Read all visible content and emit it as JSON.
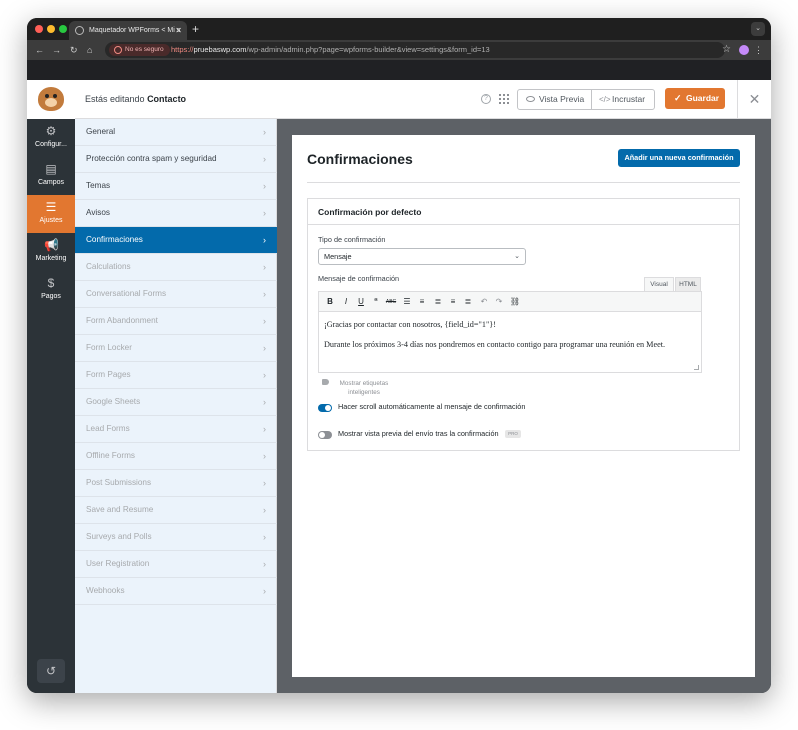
{
  "browser": {
    "tab_title": "Maquetador WPForms < Mi s",
    "tab_close": "✕",
    "new_tab": "+",
    "insecure_label": "No es seguro",
    "url_scheme": "https://",
    "url_host": "pruebaswp.com",
    "url_path": "/wp-admin/admin.php?page=wpforms-builder&view=settings&form_id=13"
  },
  "header": {
    "editing_prefix": "Estás editando",
    "form_name": "Contacto",
    "preview_label": "Vista Previa",
    "embed_label": "Incrustar",
    "save_label": "Guardar"
  },
  "sidenav": {
    "items": [
      {
        "label": "Configur...",
        "icon": "gear-icon"
      },
      {
        "label": "Campos",
        "icon": "fields-icon"
      },
      {
        "label": "Ajustes",
        "icon": "sliders-icon"
      },
      {
        "label": "Marketing",
        "icon": "megaphone-icon"
      },
      {
        "label": "Pagos",
        "icon": "dollar-icon"
      }
    ],
    "active": "Ajustes"
  },
  "settings": {
    "items": [
      {
        "label": "General",
        "state": "normal"
      },
      {
        "label": "Protección contra spam y seguridad",
        "state": "normal"
      },
      {
        "label": "Temas",
        "state": "normal"
      },
      {
        "label": "Avisos",
        "state": "normal"
      },
      {
        "label": "Confirmaciones",
        "state": "active"
      },
      {
        "label": "Calculations",
        "state": "dim"
      },
      {
        "label": "Conversational Forms",
        "state": "dim"
      },
      {
        "label": "Form Abandonment",
        "state": "dim"
      },
      {
        "label": "Form Locker",
        "state": "dim"
      },
      {
        "label": "Form Pages",
        "state": "dim"
      },
      {
        "label": "Google Sheets",
        "state": "dim"
      },
      {
        "label": "Lead Forms",
        "state": "dim"
      },
      {
        "label": "Offline Forms",
        "state": "dim"
      },
      {
        "label": "Post Submissions",
        "state": "dim"
      },
      {
        "label": "Save and Resume",
        "state": "dim"
      },
      {
        "label": "Surveys and Polls",
        "state": "dim"
      },
      {
        "label": "User Registration",
        "state": "dim"
      },
      {
        "label": "Webhooks",
        "state": "dim"
      }
    ]
  },
  "main": {
    "title": "Confirmaciones",
    "add_button": "Añadir una nueva confirmación",
    "box_title": "Confirmación por defecto",
    "type_label": "Tipo de confirmación",
    "type_value": "Mensaje",
    "message_label": "Mensaje de confirmación",
    "tab_visual": "Visual",
    "tab_html": "HTML",
    "message_line1": "¡Gracias por contactar con nosotros, {field_id=\"1\"}!",
    "message_line2": "Durante los próximos 3-4 días nos pondremos en contacto contigo para programar una reunión en Meet.",
    "smart_tags": "Mostrar etiquetas inteligentes",
    "toggle_scroll_label": "Hacer scroll automáticamente al mensaje de confirmación",
    "toggle_scroll_on": true,
    "toggle_preview_label": "Mostrar vista previa del envío tras la confirmación",
    "toggle_preview_on": false,
    "pro_badge": "PRO"
  },
  "colors": {
    "accent_orange": "#e27730",
    "accent_blue": "#036aab",
    "sidenav_bg": "#2c3338",
    "settings_bg": "#ebf3fb"
  }
}
